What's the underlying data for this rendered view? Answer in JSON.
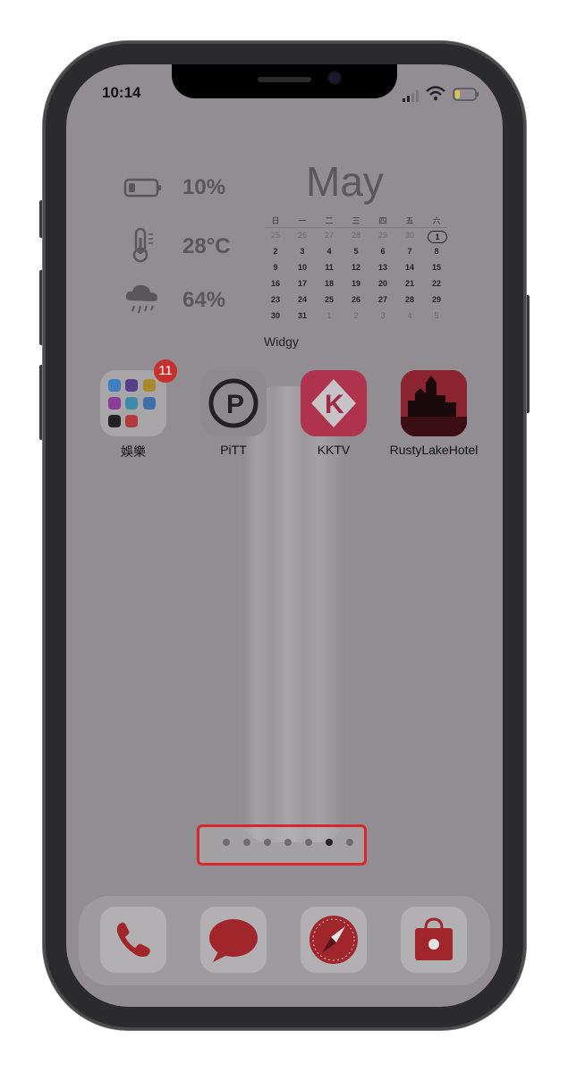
{
  "status_bar": {
    "time": "10:14"
  },
  "widget_left": {
    "battery": "10%",
    "temperature": "28°C",
    "humidity": "64%"
  },
  "widget_calendar": {
    "month": "May",
    "weekdays": [
      "日",
      "一",
      "二",
      "三",
      "四",
      "五",
      "六"
    ],
    "weeks": [
      [
        "25",
        "26",
        "27",
        "28",
        "29",
        "30",
        "1"
      ],
      [
        "2",
        "3",
        "4",
        "5",
        "6",
        "7",
        "8"
      ],
      [
        "9",
        "10",
        "11",
        "12",
        "13",
        "14",
        "15"
      ],
      [
        "16",
        "17",
        "18",
        "19",
        "20",
        "21",
        "22"
      ],
      [
        "23",
        "24",
        "25",
        "26",
        "27",
        "28",
        "29"
      ],
      [
        "30",
        "31",
        "1",
        "2",
        "3",
        "4",
        "5"
      ]
    ],
    "today": "1"
  },
  "widget_label": "Widgy",
  "apps": [
    {
      "label": "娛樂",
      "badge": "11"
    },
    {
      "label": "PiTT"
    },
    {
      "label": "KKTV"
    },
    {
      "label": "RustyLakeHotel"
    }
  ],
  "page_indicator": {
    "pages": 7,
    "current": 6
  },
  "dock": [
    "phone-icon",
    "messages-icon",
    "safari-icon",
    "app-store-icon"
  ]
}
